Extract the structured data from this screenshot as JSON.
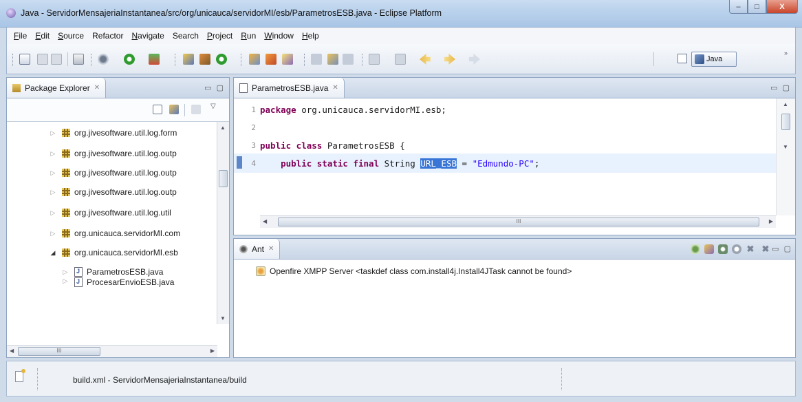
{
  "window": {
    "title": "Java - ServidorMensajeriaInstantanea/src/org/unicauca/servidorMI/esb/ParametrosESB.java - Eclipse Platform",
    "controls": {
      "minimize": "–",
      "maximize": "□",
      "close": "X"
    }
  },
  "menubar": {
    "items": [
      {
        "label": "File",
        "mnemonic": "F",
        "rest": "ile"
      },
      {
        "label": "Edit",
        "mnemonic": "E",
        "rest": "dit"
      },
      {
        "label": "Source",
        "mnemonic": "S",
        "rest": "ource"
      },
      {
        "label": "Refactor",
        "mnemonic": "",
        "rest": "Refactor"
      },
      {
        "label": "Navigate",
        "mnemonic": "N",
        "rest": "avigate"
      },
      {
        "label": "Search",
        "mnemonic": "",
        "rest": "Search"
      },
      {
        "label": "Project",
        "mnemonic": "P",
        "rest": "roject"
      },
      {
        "label": "Run",
        "mnemonic": "R",
        "rest": "un"
      },
      {
        "label": "Window",
        "mnemonic": "W",
        "rest": "indow"
      },
      {
        "label": "Help",
        "mnemonic": "H",
        "rest": "elp"
      }
    ]
  },
  "perspective": {
    "label": "Java",
    "overflow": "»"
  },
  "package_explorer": {
    "tab_label": "Package Explorer",
    "close_glyph": "✕",
    "minmax": "▭ ▢",
    "tree": [
      {
        "label": "org.jivesoftware.util.log.form",
        "type": "package",
        "expanded": false
      },
      {
        "label": "org.jivesoftware.util.log.outp",
        "type": "package",
        "expanded": false
      },
      {
        "label": "org.jivesoftware.util.log.outp",
        "type": "package",
        "expanded": false
      },
      {
        "label": "org.jivesoftware.util.log.outp",
        "type": "package",
        "expanded": false
      },
      {
        "label": "org.jivesoftware.util.log.util",
        "type": "package",
        "expanded": false
      },
      {
        "label": "org.unicauca.servidorMI.com",
        "type": "package",
        "expanded": false
      },
      {
        "label": "org.unicauca.servidorMI.esb",
        "type": "package",
        "expanded": true
      },
      {
        "label": "ParametrosESB.java",
        "type": "file",
        "expanded": false
      },
      {
        "label": "ProcesarEnvioESB.java",
        "type": "file",
        "expanded": false
      }
    ],
    "hscroll_label": "III"
  },
  "editor": {
    "tab_label": "ParametrosESB.java",
    "close_glyph": "✕",
    "minmax": "▭ ▢",
    "lines": [
      {
        "num": "1",
        "kw": "package",
        "text": " org.unicauca.servidorMI.esb;"
      },
      {
        "num": "2",
        "kw": "",
        "text": ""
      },
      {
        "num": "3",
        "kw": "public class",
        "text": " ParametrosESB {"
      },
      {
        "num": "4",
        "kw": "    public static final",
        "text": " String ",
        "selected": "URL_ESB",
        "after": " = ",
        "string": "\"Edmundo-PC\"",
        "end": ";"
      }
    ],
    "hscroll_label": "III"
  },
  "ant": {
    "tab_label": "Ant",
    "close_glyph": "✕",
    "minmax": "▭ ▢",
    "entry": "Openfire XMPP Server <taskdef class com.install4j.Install4JTask cannot be found>"
  },
  "statusbar": {
    "text": "build.xml - ServidorMensajeriaInstantanea/build"
  },
  "colors": {
    "keyword": "#7f0055",
    "string": "#2a00ff",
    "selection": "#3875d7",
    "titlebar": "#b9d1ec"
  }
}
